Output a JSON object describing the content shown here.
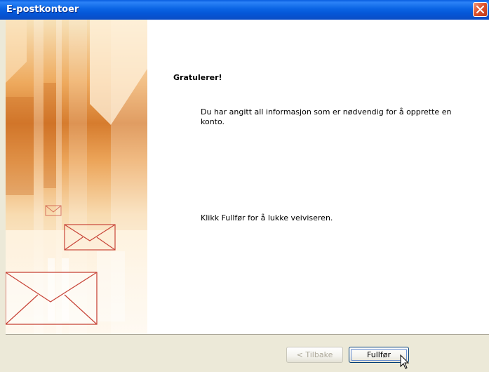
{
  "window": {
    "title": "E-postkontoer",
    "close_icon": "close-x-icon"
  },
  "content": {
    "heading": "Gratulerer!",
    "body": "Du har angitt all informasjon som er nødvendig for å opprette en konto.",
    "finish_hint": "Klikk Fullfør for å lukke veiviseren."
  },
  "buttons": {
    "back_label": "< Tilbake",
    "finish_label": "Fullfør"
  },
  "colors": {
    "titlebar": "#0a64e4",
    "window_bg": "#ece9d8",
    "art_orange": "#d67c2e",
    "envelope_stroke": "#c8463a"
  }
}
